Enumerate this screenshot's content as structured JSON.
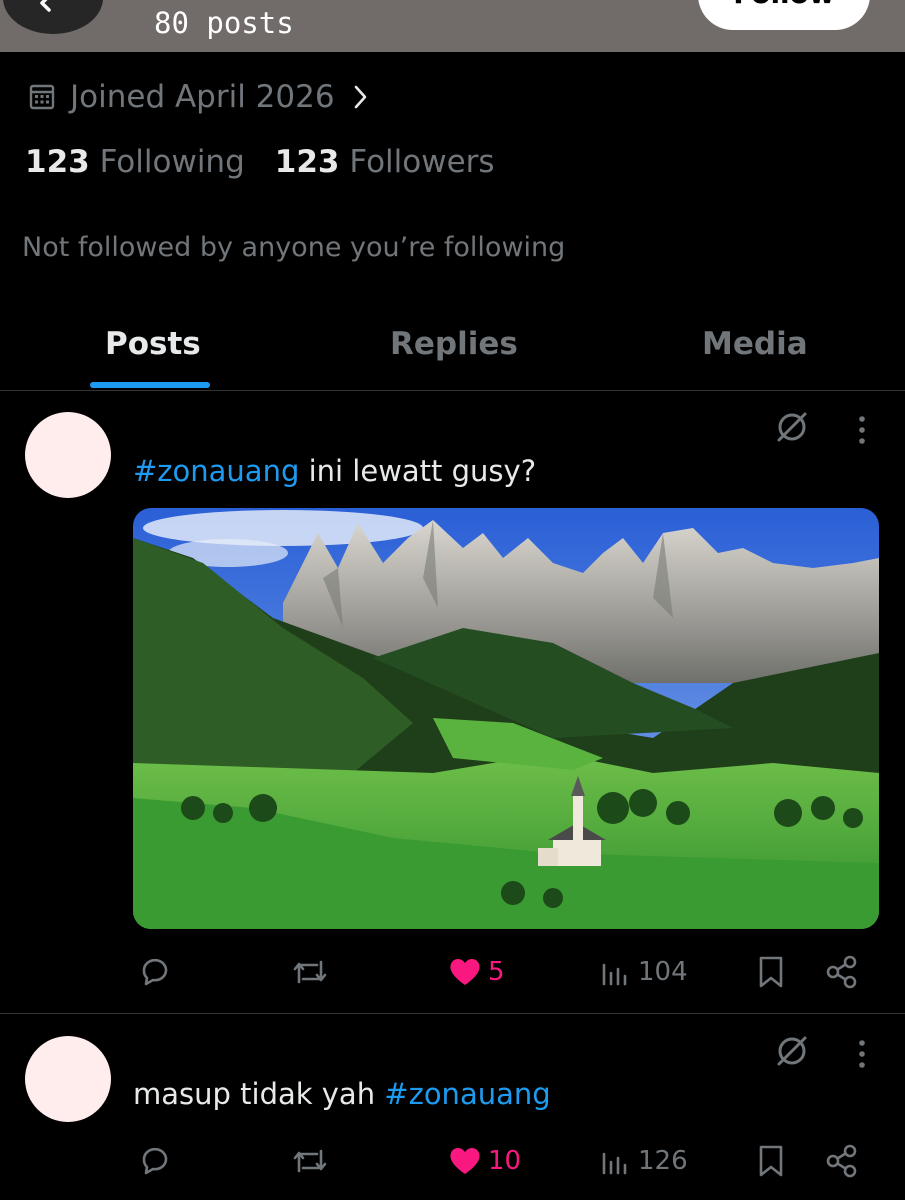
{
  "header": {
    "post_count": "80 posts",
    "follow_label": "Follow"
  },
  "profile": {
    "joined": "Joined April 2026",
    "following_count": "123",
    "following_label": "Following",
    "followers_count": "123",
    "followers_label": "Followers",
    "not_followed_text": "Not followed by anyone you’re following"
  },
  "tabs": [
    {
      "label": "Posts",
      "active": true
    },
    {
      "label": "Replies",
      "active": false
    },
    {
      "label": "Media",
      "active": false
    }
  ],
  "posts": [
    {
      "hashtag": "#zonauang",
      "text": " ini lewatt gusy?",
      "has_image": true,
      "image_description_icon": "mountain-valley-photo",
      "likes": "5",
      "views": "104",
      "liked": true
    },
    {
      "text": "masup tidak yah ",
      "hashtag": "#zonauang",
      "has_image": false,
      "likes": "10",
      "views": "126",
      "liked": true
    }
  ],
  "icons": {
    "back": "arrow-left-icon",
    "calendar": "calendar-icon",
    "chevron": "chevron-right-icon",
    "no_image": "no-media-icon",
    "more": "more-vertical-icon",
    "reply": "reply-icon",
    "repost": "repost-icon",
    "like": "heart-icon",
    "views": "views-icon",
    "bookmark": "bookmark-icon",
    "share": "share-icon"
  },
  "colors": {
    "accent": "#1d9bf0",
    "like": "#f91880",
    "muted": "#71767b",
    "header_bg": "#716b69",
    "avatar": "#ffeded"
  }
}
